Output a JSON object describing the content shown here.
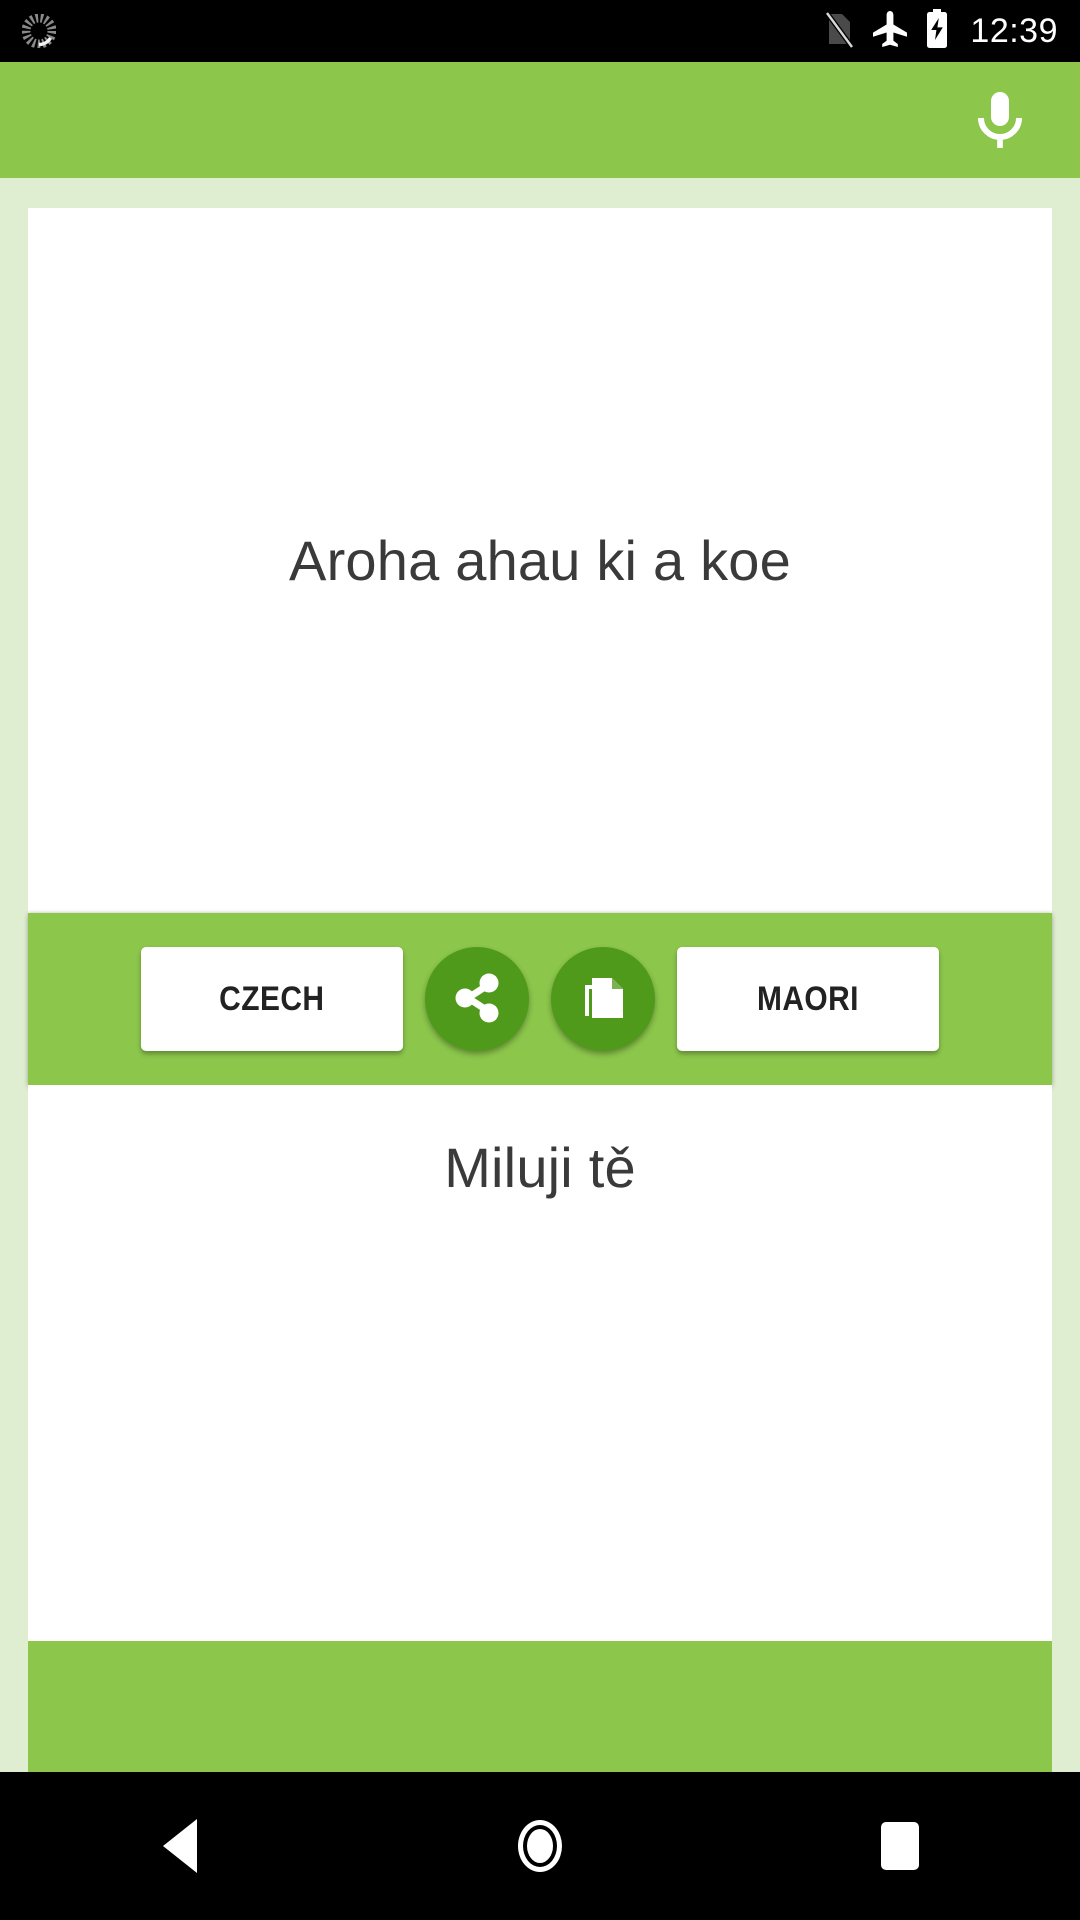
{
  "status_bar": {
    "icons_left": [
      {
        "name": "sync-spinner-icon",
        "glyph": "spinner"
      }
    ],
    "icons_right": [
      {
        "name": "no-sim-icon",
        "glyph": "no-sim"
      },
      {
        "name": "airplane-mode-icon",
        "glyph": "airplane"
      },
      {
        "name": "battery-charging-icon",
        "glyph": "battery-charging"
      }
    ],
    "time": "12:39"
  },
  "app_bar": {
    "mic_icon": "microphone-icon",
    "background_color": "#8cc64b"
  },
  "source_panel": {
    "text": "Aroha ahau ki a koe"
  },
  "controls": {
    "source_language": "CZECH",
    "target_language": "MAORI",
    "share_icon": "share-icon",
    "copy_icon": "copy-icon",
    "bar_color": "#8cc64b",
    "round_button_color": "#4f9a1b"
  },
  "target_panel": {
    "text": "Miluji tě"
  },
  "bottom_banner": {
    "color": "#8cc64b"
  },
  "nav_bar": {
    "back": "back-button",
    "home": "home-button",
    "recents": "recents-button"
  },
  "theme": {
    "accent": "#8cc64b",
    "accent_dark": "#4f9a1b",
    "page_background": "#dfedd1",
    "card_background": "#ffffff",
    "text_color": "#3a3a3a"
  }
}
